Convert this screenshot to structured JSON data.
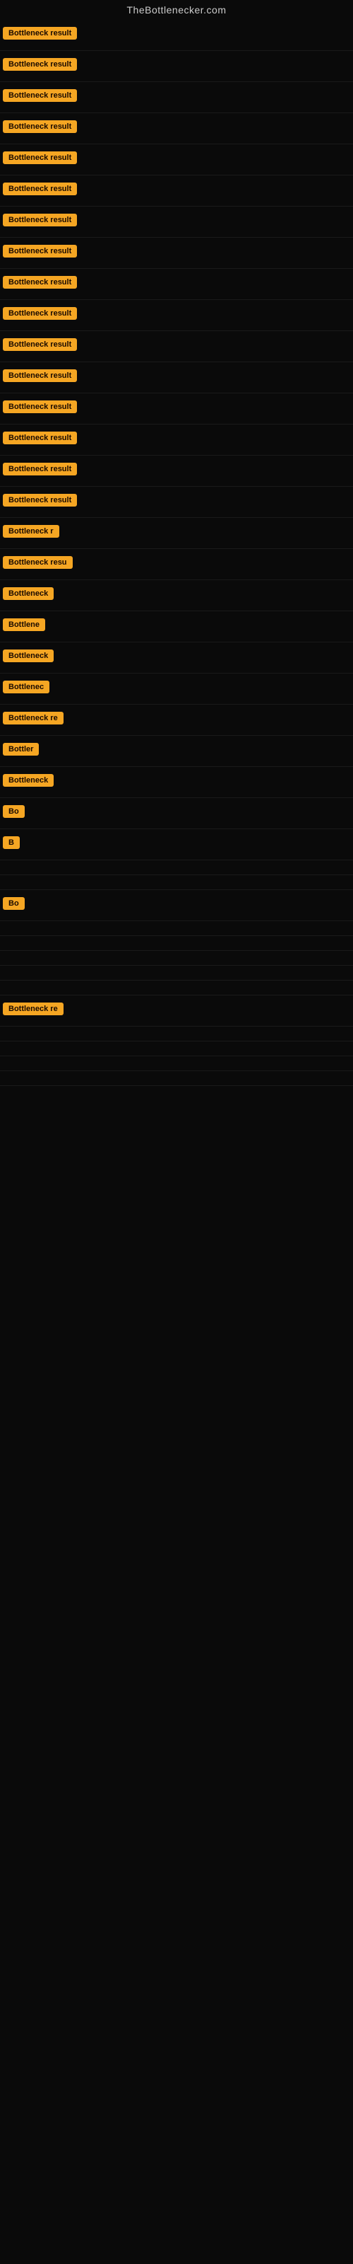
{
  "site": {
    "title": "TheBottlenecker.com"
  },
  "rows": [
    {
      "label": "Bottleneck result",
      "truncated": false
    },
    {
      "label": "Bottleneck result",
      "truncated": false
    },
    {
      "label": "Bottleneck result",
      "truncated": false
    },
    {
      "label": "Bottleneck result",
      "truncated": false
    },
    {
      "label": "Bottleneck result",
      "truncated": false
    },
    {
      "label": "Bottleneck result",
      "truncated": false
    },
    {
      "label": "Bottleneck result",
      "truncated": false
    },
    {
      "label": "Bottleneck result",
      "truncated": false
    },
    {
      "label": "Bottleneck result",
      "truncated": false
    },
    {
      "label": "Bottleneck result",
      "truncated": false
    },
    {
      "label": "Bottleneck result",
      "truncated": false
    },
    {
      "label": "Bottleneck result",
      "truncated": false
    },
    {
      "label": "Bottleneck result",
      "truncated": false
    },
    {
      "label": "Bottleneck result",
      "truncated": false
    },
    {
      "label": "Bottleneck result",
      "truncated": false
    },
    {
      "label": "Bottleneck result",
      "truncated": false
    },
    {
      "label": "Bottleneck r",
      "truncated": true
    },
    {
      "label": "Bottleneck resu",
      "truncated": true
    },
    {
      "label": "Bottleneck",
      "truncated": true
    },
    {
      "label": "Bottlene",
      "truncated": true
    },
    {
      "label": "Bottleneck",
      "truncated": true
    },
    {
      "label": "Bottlenec",
      "truncated": true
    },
    {
      "label": "Bottleneck re",
      "truncated": true
    },
    {
      "label": "Bottler",
      "truncated": true
    },
    {
      "label": "Bottleneck",
      "truncated": true
    },
    {
      "label": "Bo",
      "truncated": true
    },
    {
      "label": "B",
      "truncated": true
    },
    {
      "label": "",
      "truncated": true
    },
    {
      "label": "",
      "truncated": true
    },
    {
      "label": "Bo",
      "truncated": true
    },
    {
      "label": "",
      "truncated": true
    },
    {
      "label": "",
      "truncated": true
    },
    {
      "label": "",
      "truncated": true
    },
    {
      "label": "",
      "truncated": true
    },
    {
      "label": "",
      "truncated": true
    },
    {
      "label": "Bottleneck re",
      "truncated": true
    },
    {
      "label": "",
      "truncated": true
    },
    {
      "label": "",
      "truncated": true
    },
    {
      "label": "",
      "truncated": true
    },
    {
      "label": "",
      "truncated": true
    }
  ]
}
